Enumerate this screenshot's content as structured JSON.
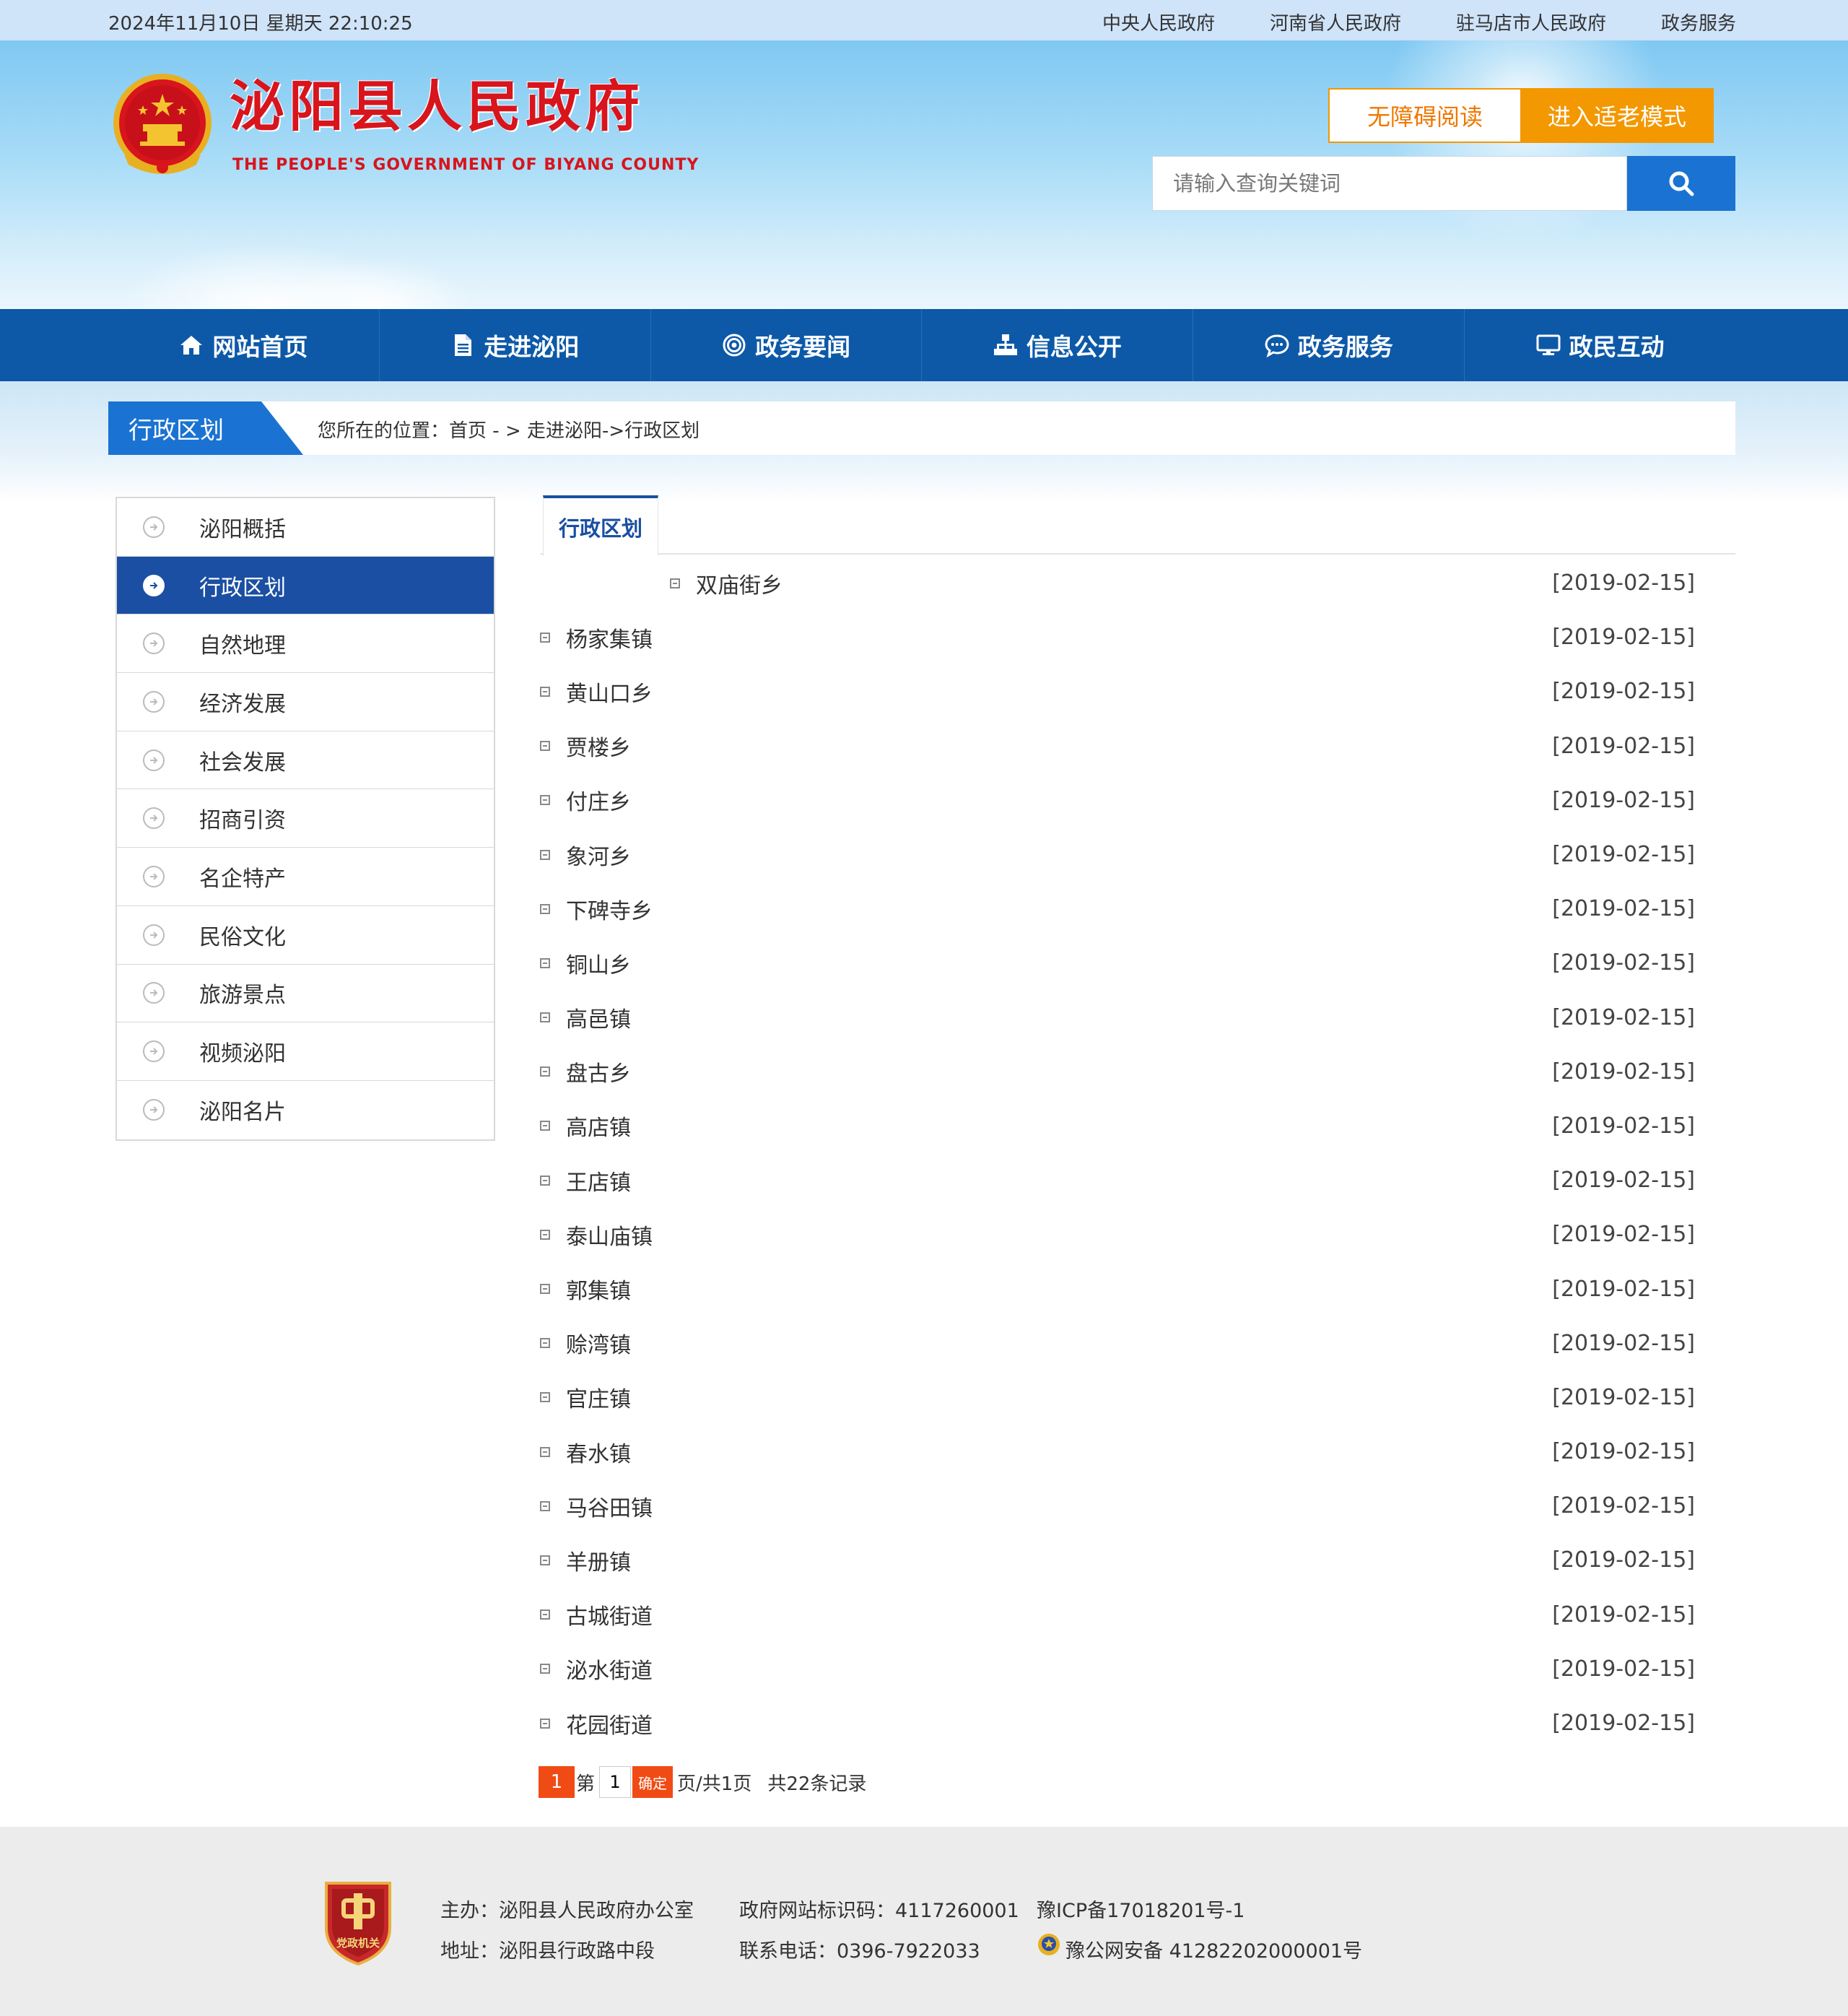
{
  "topbar": {
    "datetime": "2024年11月10日 星期天 22:10:25",
    "links": [
      "中央人民政府",
      "河南省人民政府",
      "驻马店市人民政府",
      "政务服务"
    ]
  },
  "header": {
    "title": "泌阳县人民政府",
    "subtitle": "THE PEOPLE'S GOVERNMENT OF BIYANG COUNTY",
    "accessible_label": "无障碍阅读",
    "elder_label": "进入适老模式",
    "search_placeholder": "请输入查询关键词"
  },
  "nav": [
    {
      "label": "网站首页",
      "icon": "home-icon"
    },
    {
      "label": "走进泌阳",
      "icon": "document-icon"
    },
    {
      "label": "政务要闻",
      "icon": "target-icon"
    },
    {
      "label": "信息公开",
      "icon": "sitemap-icon"
    },
    {
      "label": "政务服务",
      "icon": "chat-icon"
    },
    {
      "label": "政民互动",
      "icon": "monitor-icon"
    }
  ],
  "breadcrumb": {
    "section": "行政区划",
    "prefix": "您所在的位置：",
    "home": "首页",
    "sep1": " - > ",
    "path": "走进泌阳->行政区划"
  },
  "sidebar": {
    "active_index": 1,
    "items": [
      "泌阳概括",
      "行政区划",
      "自然地理",
      "经济发展",
      "社会发展",
      "招商引资",
      "名企特产",
      "民俗文化",
      "旅游景点",
      "视频泌阳",
      "泌阳名片"
    ]
  },
  "main": {
    "tab": "行政区划",
    "items": [
      {
        "name": "双庙街乡",
        "date": "[2019-02-15]"
      },
      {
        "name": "杨家集镇",
        "date": "[2019-02-15]"
      },
      {
        "name": "黄山口乡",
        "date": "[2019-02-15]"
      },
      {
        "name": "贾楼乡",
        "date": "[2019-02-15]"
      },
      {
        "name": "付庄乡",
        "date": "[2019-02-15]"
      },
      {
        "name": "象河乡",
        "date": "[2019-02-15]"
      },
      {
        "name": "下碑寺乡",
        "date": "[2019-02-15]"
      },
      {
        "name": "铜山乡",
        "date": "[2019-02-15]"
      },
      {
        "name": "高邑镇",
        "date": "[2019-02-15]"
      },
      {
        "name": "盘古乡",
        "date": "[2019-02-15]"
      },
      {
        "name": "高店镇",
        "date": "[2019-02-15]"
      },
      {
        "name": "王店镇",
        "date": "[2019-02-15]"
      },
      {
        "name": "泰山庙镇",
        "date": "[2019-02-15]"
      },
      {
        "name": "郭集镇",
        "date": "[2019-02-15]"
      },
      {
        "name": "赊湾镇",
        "date": "[2019-02-15]"
      },
      {
        "name": "官庄镇",
        "date": "[2019-02-15]"
      },
      {
        "name": "春水镇",
        "date": "[2019-02-15]"
      },
      {
        "name": "马谷田镇",
        "date": "[2019-02-15]"
      },
      {
        "name": "羊册镇",
        "date": "[2019-02-15]"
      },
      {
        "name": "古城街道",
        "date": "[2019-02-15]"
      },
      {
        "name": "泌水街道",
        "date": "[2019-02-15]"
      },
      {
        "name": "花园街道",
        "date": "[2019-02-15]"
      }
    ]
  },
  "pager": {
    "current": "1",
    "di": "第",
    "input_value": "1",
    "ok": "确定",
    "pages": "页/共1页",
    "total": "共22条记录"
  },
  "footer": {
    "host": "主办：泌阳县人民政府办公室",
    "address": "地址：泌阳县行政路中段",
    "site_code": "政府网站标识码：4117260001",
    "phone": "联系电话：0396-7922033",
    "icp": "豫ICP备17018201号-1",
    "police": "豫公网安备 41282202000001号",
    "badge_text": "党政机关"
  },
  "colors": {
    "brand_red": "#d8141c",
    "nav_blue": "#0d59a8",
    "accent_blue": "#1a73d2",
    "active_blue": "#1a4fa3",
    "orange": "#f39800",
    "pager_orange": "#f04b14"
  }
}
